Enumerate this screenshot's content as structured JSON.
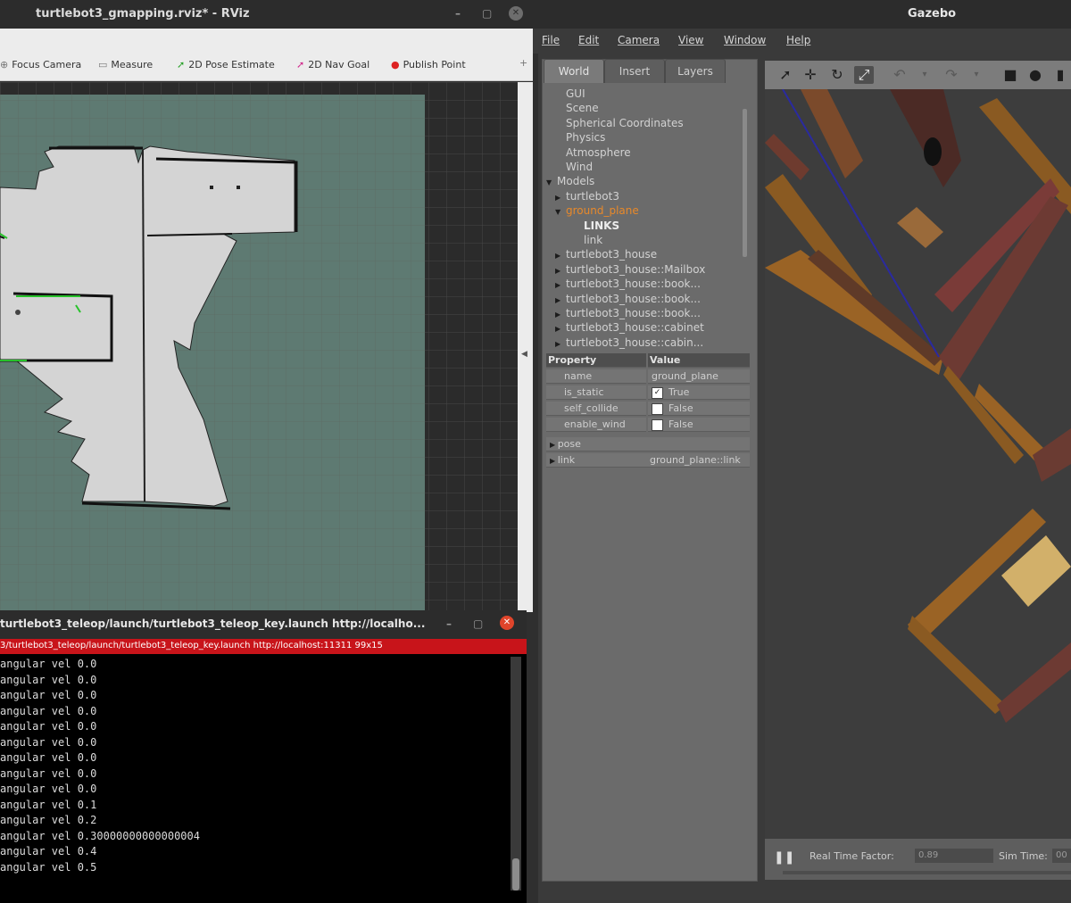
{
  "rviz": {
    "title": "turtlebot3_gmapping.rviz* - RViz",
    "toolbar": [
      {
        "label": "Focus Camera",
        "icon": "crosshair-icon"
      },
      {
        "label": "Measure",
        "icon": "ruler-icon"
      },
      {
        "label": "2D Pose Estimate",
        "icon": "green-arrow-icon"
      },
      {
        "label": "2D Nav Goal",
        "icon": "pink-arrow-icon"
      },
      {
        "label": "Publish Point",
        "icon": "red-pin-icon"
      }
    ]
  },
  "terminal": {
    "title": "turtlebot3_teleop/launch/turtlebot3_teleop_key.launch http://localho...",
    "red_bar": "3/turtlebot3_teleop/launch/turtlebot3_teleop_key.launch http://localhost:11311 99x15",
    "lines": [
      "angular vel 0.0",
      "angular vel 0.0",
      "angular vel 0.0",
      "angular vel 0.0",
      "angular vel 0.0",
      "angular vel 0.0",
      "angular vel 0.0",
      "angular vel 0.0",
      "angular vel 0.0",
      "angular vel 0.1",
      "angular vel 0.2",
      "angular vel 0.30000000000000004",
      "angular vel 0.4",
      "angular vel 0.5"
    ]
  },
  "gazebo": {
    "title": "Gazebo",
    "menu": [
      "File",
      "Edit",
      "Camera",
      "View",
      "Window",
      "Help"
    ],
    "tabs": [
      "World",
      "Insert",
      "Layers"
    ],
    "tree": [
      {
        "label": "GUI",
        "indent": 1,
        "tri": ""
      },
      {
        "label": "Scene",
        "indent": 1,
        "tri": ""
      },
      {
        "label": "Spherical Coordinates",
        "indent": 1,
        "tri": ""
      },
      {
        "label": "Physics",
        "indent": 1,
        "tri": ""
      },
      {
        "label": "Atmosphere",
        "indent": 1,
        "tri": ""
      },
      {
        "label": "Wind",
        "indent": 1,
        "tri": ""
      },
      {
        "label": "Models",
        "indent": 0,
        "tri": "▼"
      },
      {
        "label": "turtlebot3",
        "indent": 1,
        "tri": "▶"
      },
      {
        "label": "ground_plane",
        "indent": 1,
        "tri": "▼",
        "selected": true
      },
      {
        "label": "LINKS",
        "indent": 3,
        "tri": "",
        "bold": true
      },
      {
        "label": "link",
        "indent": 3,
        "tri": ""
      },
      {
        "label": "turtlebot3_house",
        "indent": 1,
        "tri": "▶"
      },
      {
        "label": "turtlebot3_house::Mailbox",
        "indent": 1,
        "tri": "▶"
      },
      {
        "label": "turtlebot3_house::book...",
        "indent": 1,
        "tri": "▶"
      },
      {
        "label": "turtlebot3_house::book...",
        "indent": 1,
        "tri": "▶"
      },
      {
        "label": "turtlebot3_house::book...",
        "indent": 1,
        "tri": "▶"
      },
      {
        "label": "turtlebot3_house::cabinet",
        "indent": 1,
        "tri": "▶"
      },
      {
        "label": "turtlebot3_house::cabin...",
        "indent": 1,
        "tri": "▶"
      }
    ],
    "props_header": {
      "key": "Property",
      "value": "Value"
    },
    "props": [
      {
        "key": "name",
        "value": "ground_plane",
        "checkbox": null
      },
      {
        "key": "is_static",
        "value": "True",
        "checkbox": true
      },
      {
        "key": "self_collide",
        "value": "False",
        "checkbox": false
      },
      {
        "key": "enable_wind",
        "value": "False",
        "checkbox": false
      },
      {
        "key": "pose",
        "value": "",
        "expandable": true
      },
      {
        "key": "link",
        "value": "ground_plane::link",
        "expandable": true
      }
    ],
    "bottom": {
      "rtf_label": "Real Time Factor:",
      "rtf_value": "0.89",
      "sim_label": "Sim Time:",
      "sim_value": "00"
    }
  }
}
